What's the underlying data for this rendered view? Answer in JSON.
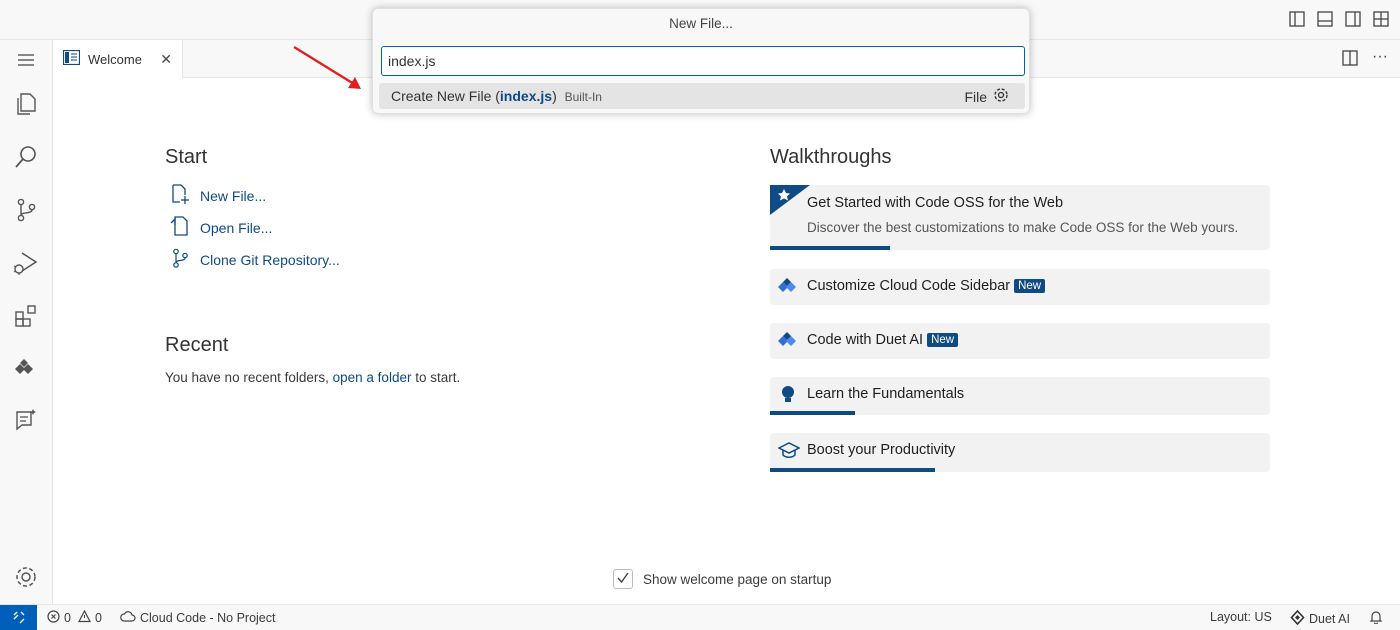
{
  "palette": {
    "title": "New File...",
    "input_value": "index.js",
    "result": {
      "prefix": "Create New File (",
      "highlight": "index.js",
      "suffix": ")",
      "builtin": "Built-In",
      "kind": "File"
    }
  },
  "tab": {
    "label": "Welcome"
  },
  "start": {
    "heading": "Start",
    "links": [
      "New File...",
      "Open File...",
      "Clone Git Repository..."
    ]
  },
  "recent": {
    "heading": "Recent",
    "text_before": "You have no recent folders,",
    "link": "open a folder",
    "text_after": "to start."
  },
  "walkthroughs": {
    "heading": "Walkthroughs",
    "items": [
      {
        "title": "Get Started with Code OSS for the Web",
        "description": "Discover the best customizations to make Code OSS for the Web yours.",
        "progress": 0.24
      },
      {
        "title": "Customize Cloud Code Sidebar",
        "badge": "New"
      },
      {
        "title": "Code with Duet AI",
        "badge": "New"
      },
      {
        "title": "Learn the Fundamentals",
        "progress": 0.17
      },
      {
        "title": "Boost your Productivity",
        "progress": 0.33
      }
    ]
  },
  "startup_checkbox": {
    "label": "Show welcome page on startup",
    "checked": true
  },
  "statusbar": {
    "errors": "0",
    "warnings": "0",
    "cloud_code": "Cloud Code - No Project",
    "layout": "Layout: US",
    "duet": "Duet AI"
  },
  "colors": {
    "accent": "#005fb8",
    "link": "#0f4a85",
    "arrow": "#e02020"
  }
}
